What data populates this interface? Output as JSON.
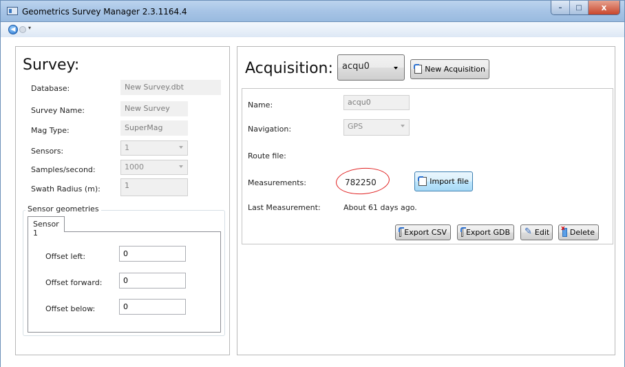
{
  "window": {
    "title": "Geometrics Survey Manager 2.3.1164.4",
    "minimize_glyph": "–",
    "maximize_glyph": "□",
    "close_glyph": "x"
  },
  "nav": {
    "back_glyph": "◀",
    "dropdown_glyph": "▾"
  },
  "survey": {
    "title": "Survey:",
    "database_label": "Database:",
    "database_value": "New Survey.dbt",
    "name_label": "Survey Name:",
    "name_value": "New Survey",
    "magtype_label": "Mag Type:",
    "magtype_value": "SuperMag",
    "sensors_label": "Sensors:",
    "sensors_value": "1",
    "samples_label": "Samples/second:",
    "samples_value": "1000",
    "swath_label": "Swath Radius (m):",
    "swath_value": "1",
    "geometries": {
      "legend": "Sensor geometries",
      "tab_label": "Sensor 1",
      "offset_left_label": "Offset left:",
      "offset_left_value": "0",
      "offset_forward_label": "Offset forward:",
      "offset_forward_value": "0",
      "offset_below_label": "Offset below:",
      "offset_below_value": "0"
    }
  },
  "acquisition": {
    "title": "Acquisition:",
    "selected": "acqu0",
    "new_button": "New Acquisition",
    "name_label": "Name:",
    "name_value": "acqu0",
    "navigation_label": "Navigation:",
    "navigation_value": "GPS",
    "route_label": "Route file:",
    "measurements_label": "Measurements:",
    "measurements_value": "782250",
    "import_button": "Import file",
    "last_label": "Last Measurement:",
    "last_value": "About 61 days ago.",
    "export_csv": "Export CSV",
    "export_gdb": "Export GDB",
    "edit": "Edit",
    "delete": "Delete"
  },
  "colors": {
    "title_bar": "#a7c4e6",
    "annotation": "#e02020",
    "button_hover": "#bee6fd"
  }
}
